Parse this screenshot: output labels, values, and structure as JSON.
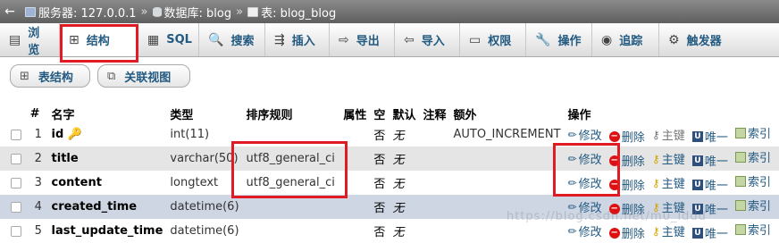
{
  "breadcrumb": {
    "back": "←",
    "server": "服务器: 127.0.0.1",
    "database": "数据库: blog",
    "table": "表: blog_blog",
    "sep": "»"
  },
  "tabs": [
    {
      "label": "浏览",
      "icon": "browse-icon",
      "glyph": "▤"
    },
    {
      "label": "结构",
      "icon": "structure-icon",
      "glyph": "⊞"
    },
    {
      "label": "SQL",
      "icon": "sql-icon",
      "glyph": "▦"
    },
    {
      "label": "搜索",
      "icon": "search-icon",
      "glyph": "🔍"
    },
    {
      "label": "插入",
      "icon": "insert-icon",
      "glyph": "⇶"
    },
    {
      "label": "导出",
      "icon": "export-icon",
      "glyph": "⇨"
    },
    {
      "label": "导入",
      "icon": "import-icon",
      "glyph": "⇦"
    },
    {
      "label": "权限",
      "icon": "privileges-icon",
      "glyph": "▭"
    },
    {
      "label": "操作",
      "icon": "operations-icon",
      "glyph": "🔧"
    },
    {
      "label": "追踪",
      "icon": "tracking-icon",
      "glyph": "◉"
    },
    {
      "label": "触发器",
      "icon": "triggers-icon",
      "glyph": "⚙"
    }
  ],
  "subtabs": {
    "structure": "表结构",
    "relation": "关联视图"
  },
  "table": {
    "headers": [
      "#",
      "名字",
      "类型",
      "排序规则",
      "属性",
      "空",
      "默认",
      "注释",
      "额外",
      "操作"
    ],
    "actions": {
      "edit": "修改",
      "drop": "删除",
      "primary": "主键",
      "unique": "唯一",
      "index": "索引"
    },
    "rows": [
      {
        "num": "1",
        "name": "id",
        "type": "int(11)",
        "collation": "",
        "attributes": "",
        "null": "否",
        "default": "无",
        "comment": "",
        "extra": "AUTO_INCREMENT"
      },
      {
        "num": "2",
        "name": "title",
        "type": "varchar(50)",
        "collation": "utf8_general_ci",
        "attributes": "",
        "null": "否",
        "default": "无",
        "comment": "",
        "extra": ""
      },
      {
        "num": "3",
        "name": "content",
        "type": "longtext",
        "collation": "utf8_general_ci",
        "attributes": "",
        "null": "否",
        "default": "无",
        "comment": "",
        "extra": ""
      },
      {
        "num": "4",
        "name": "created_time",
        "type": "datetime(6)",
        "collation": "",
        "attributes": "",
        "null": "否",
        "default": "无",
        "comment": "",
        "extra": ""
      },
      {
        "num": "5",
        "name": "last_update_time",
        "type": "datetime(6)",
        "collation": "",
        "attributes": "",
        "null": "否",
        "default": "无",
        "comment": "",
        "extra": ""
      }
    ]
  },
  "watermark": "https://blog.csdn.net/m0_lddd",
  "colors": {
    "accent": "#235a81",
    "annotation": "#e01b24"
  }
}
